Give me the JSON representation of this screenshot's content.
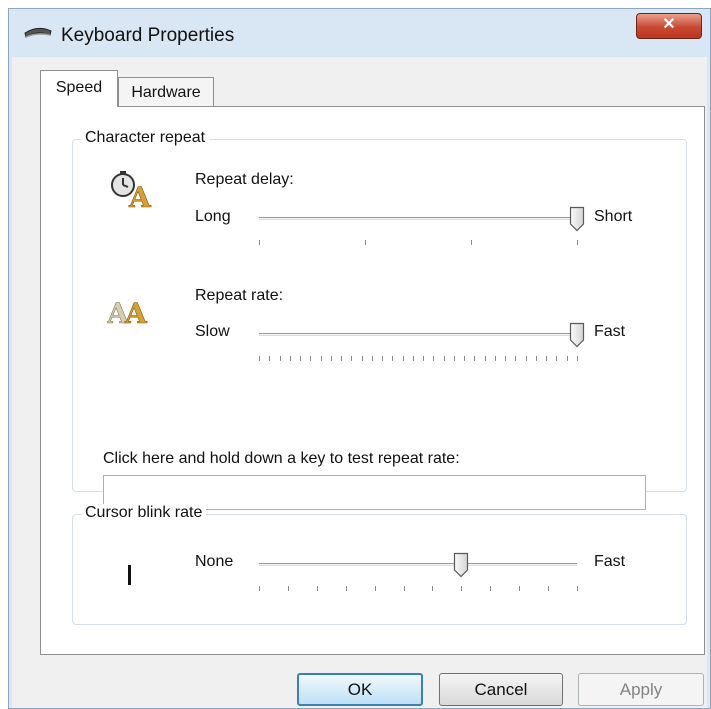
{
  "window": {
    "title": "Keyboard Properties",
    "close_glyph": "✕"
  },
  "tabs": [
    {
      "label": "Speed"
    },
    {
      "label": "Hardware"
    }
  ],
  "character_repeat": {
    "group_title": "Character repeat",
    "repeat_delay": {
      "label": "Repeat delay:",
      "left": "Long",
      "right": "Short",
      "position": 3,
      "max": 3,
      "icon": "clock-letter-a-icon"
    },
    "repeat_rate": {
      "label": "Repeat rate:",
      "left": "Slow",
      "right": "Fast",
      "position": 31,
      "max": 31,
      "icon": "double-letter-a-icon"
    },
    "test_prompt": "Click here and hold down a key to test repeat rate:",
    "test_value": ""
  },
  "cursor_blink": {
    "group_title": "Cursor blink rate",
    "left": "None",
    "right": "Fast",
    "position": 7,
    "max": 11,
    "icon": "cursor-bar-icon"
  },
  "buttons": {
    "ok": "OK",
    "cancel": "Cancel",
    "apply": "Apply"
  },
  "colors": {
    "title_bg": "#d9e6f3",
    "close_red": "#c94a33",
    "ok_border": "#3c7fb1"
  }
}
